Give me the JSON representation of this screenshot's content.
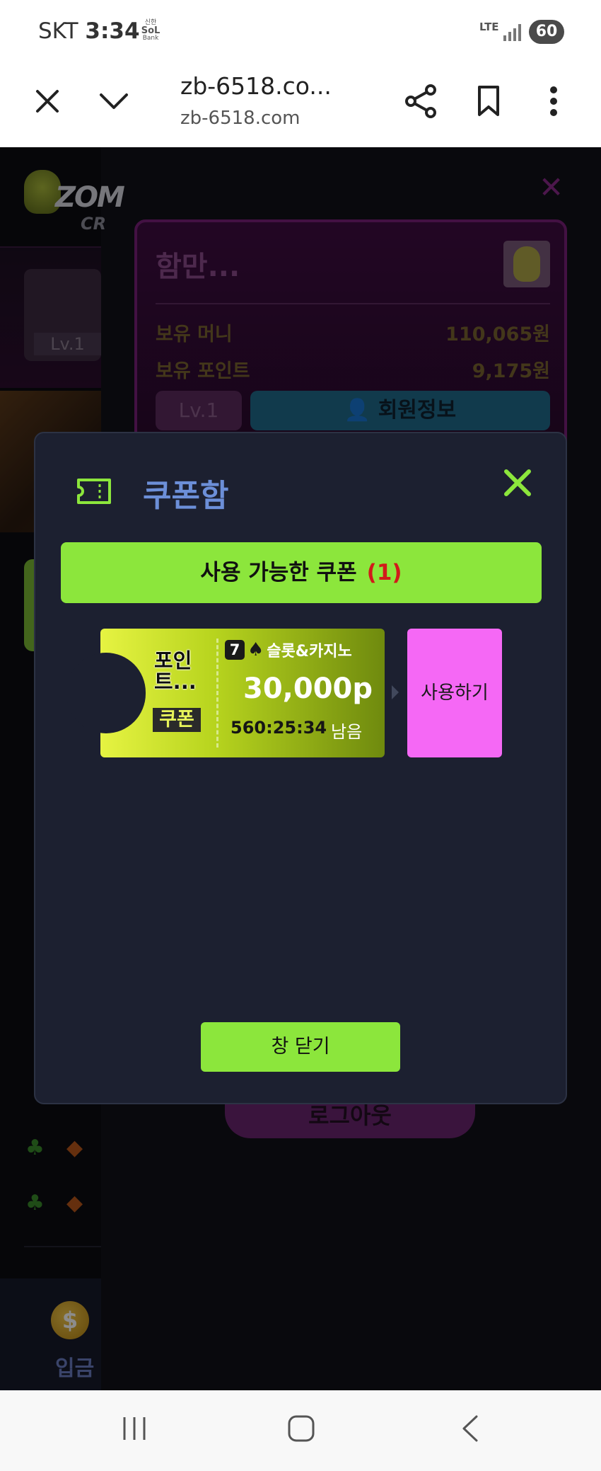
{
  "status_bar": {
    "carrier": "SKT",
    "time": "3:34",
    "bank_line1": "신한",
    "bank_line2": "SoL",
    "bank_line3": "Bank",
    "network": "LTE",
    "battery": "60"
  },
  "browser": {
    "title": "zb-6518.co...",
    "url": "zb-6518.com"
  },
  "background": {
    "logo_text": "ZOM",
    "logo_sub": "CR",
    "level_badge": "Lv.1",
    "profile_name": "함만...",
    "money_label": "보유 머니",
    "money_value": "110,065원",
    "points_label": "보유 포인트",
    "points_value": "9,175원",
    "level_button": "Lv.1",
    "member_info_button": "회원정보",
    "logout_button": "로그아웃",
    "deposit_label": "입금",
    "coin_symbol": "$",
    "club_suit": "♣",
    "diamond_suit": "◆"
  },
  "modal": {
    "title": "쿠폰함",
    "available_label": "사용 가능한 쿠폰",
    "available_count": "(1)",
    "close_window_button": "창 닫기",
    "coupons": [
      {
        "name_line1": "포인",
        "name_line2": "트...",
        "badge": "쿠폰",
        "type_icon": "7",
        "type_suit": "♠",
        "type_label": "슬롯&카지노",
        "amount": "30,000p",
        "timer": "560:25:34",
        "remaining_label": "남음",
        "use_button": "사용하기"
      }
    ]
  },
  "colors": {
    "accent_green": "#8ce63c",
    "use_pink": "#f568f5",
    "title_blue": "#6c8fd8",
    "count_red": "#d21a1a"
  }
}
